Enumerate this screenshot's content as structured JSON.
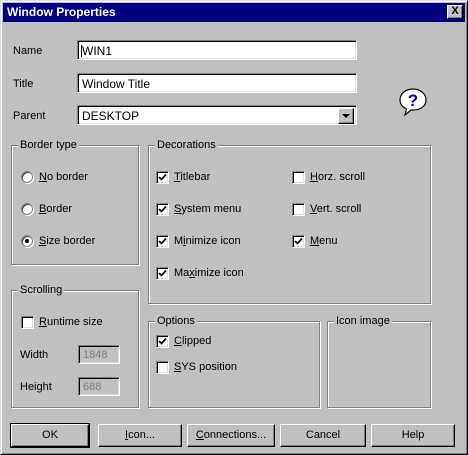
{
  "window": {
    "title": "Window Properties",
    "close_symbol": "X"
  },
  "fields": {
    "name_label": "Name",
    "name_value": "WIN1",
    "title_label": "Title",
    "title_value": "Window Title",
    "parent_label": "Parent",
    "parent_value": "DESKTOP"
  },
  "border_type": {
    "title": "Border type",
    "options": [
      {
        "label": "No border",
        "mnemonic": "N",
        "rest": "o border",
        "selected": false
      },
      {
        "label": "Border",
        "mnemonic": "B",
        "rest": "order",
        "selected": false
      },
      {
        "label": "Size border",
        "mnemonic": "S",
        "rest": "ize border",
        "selected": true
      }
    ]
  },
  "decorations": {
    "title": "Decorations",
    "left": [
      {
        "label": "Titlebar",
        "pre": "",
        "mnemonic": "T",
        "rest": "itlebar",
        "checked": true
      },
      {
        "label": "System menu",
        "pre": "",
        "mnemonic": "S",
        "rest": "ystem menu",
        "checked": true
      },
      {
        "label": "Minimize icon",
        "pre": "M",
        "mnemonic": "i",
        "rest": "nimize icon",
        "checked": true
      },
      {
        "label": "Maximize icon",
        "pre": "Ma",
        "mnemonic": "x",
        "rest": "imize icon",
        "checked": true
      }
    ],
    "right": [
      {
        "label": "Horz. scroll",
        "pre": "",
        "mnemonic": "H",
        "rest": "orz. scroll",
        "checked": false
      },
      {
        "label": "Vert. scroll",
        "pre": "",
        "mnemonic": "V",
        "rest": "ert. scroll",
        "checked": false
      },
      {
        "label": "Menu",
        "pre": "",
        "mnemonic": "M",
        "rest": "enu",
        "checked": true
      }
    ]
  },
  "scrolling": {
    "title": "Scrolling",
    "runtime_pre": "",
    "runtime_mnemonic": "R",
    "runtime_rest": "untime size",
    "runtime_checked": false,
    "width_label": "Width",
    "width_value": "1848",
    "height_label": "Height",
    "height_value": "688"
  },
  "options": {
    "title": "Options",
    "items": [
      {
        "label": "Clipped",
        "pre": "",
        "mnemonic": "C",
        "rest": "lipped",
        "checked": true
      },
      {
        "label": "SYS position",
        "pre": "",
        "mnemonic": "S",
        "rest": "YS position",
        "checked": false
      }
    ]
  },
  "icon_image": {
    "title": "Icon image"
  },
  "buttons": {
    "ok": "OK",
    "icon_mn": "I",
    "icon_rest": "con...",
    "conn_mn": "C",
    "conn_rest": "onnections...",
    "cancel": "Cancel",
    "help": "Help"
  },
  "colors": {
    "titlebar": "#000080",
    "face": "#c0c0c0",
    "help_icon": "#0000cc"
  }
}
